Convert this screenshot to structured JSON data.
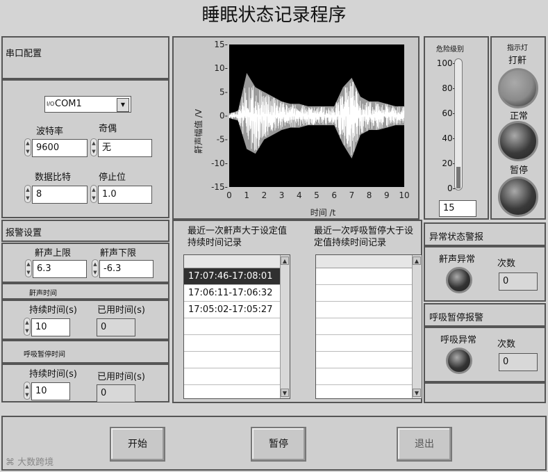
{
  "app": {
    "title": "睡眠状态记录程序"
  },
  "serial": {
    "section_label": "串口配置",
    "port_value": "COM1",
    "port_prefix": "I/O",
    "baud_label": "波特率",
    "baud_value": "9600",
    "parity_label": "奇偶",
    "parity_value": "无",
    "databits_label": "数据比特",
    "databits_value": "8",
    "stopbits_label": "停止位",
    "stopbits_value": "1.0"
  },
  "alarm": {
    "section_label": "报警设置",
    "upper_label": "鼾声上限",
    "upper_value": "6.3",
    "lower_label": "鼾声下限",
    "lower_value": "-6.3",
    "snore_time_label": "鼾声时间",
    "snore_duration_label": "持续时间(s)",
    "snore_duration_value": "10",
    "snore_elapsed_label": "已用时间(s)",
    "snore_elapsed_value": "0",
    "apnea_time_label": "呼吸暂停时间",
    "apnea_duration_label": "持续时间(s)",
    "apnea_duration_value": "10",
    "apnea_elapsed_label": "已用时间(s)",
    "apnea_elapsed_value": "0"
  },
  "chart_data": {
    "type": "line",
    "xlabel": "时间 /t",
    "ylabel": "鼾声幅值 /V",
    "xlim": [
      0,
      10
    ],
    "ylim": [
      -15,
      15
    ],
    "x_ticks": [
      "0",
      "1",
      "2",
      "3",
      "4",
      "5",
      "6",
      "7",
      "8",
      "9",
      "10"
    ],
    "y_ticks": [
      "15-",
      "10-",
      "5-",
      "0-",
      "-5-",
      "-10-",
      "-15-"
    ],
    "grid": false,
    "background": "#000000",
    "line_color": "#ffffff",
    "series": [
      {
        "x": [
          0,
          0.5,
          1,
          1.5,
          2,
          2.5,
          3,
          3.5,
          4,
          4.5,
          5,
          5.5,
          6,
          6.5,
          7,
          7.5,
          8,
          8.5,
          9,
          9.5,
          10
        ],
        "y_max": [
          0.5,
          1,
          9,
          6,
          5,
          4,
          3,
          2.5,
          2.5,
          2,
          2,
          2,
          2,
          6,
          8,
          4,
          3,
          3,
          2.5,
          2,
          2
        ],
        "y_min": [
          -0.5,
          -1,
          -7,
          -8,
          -5,
          -4,
          -3,
          -2.5,
          -2.5,
          -2,
          -2,
          -2,
          -2,
          -6,
          -9,
          -4,
          -3,
          -3,
          -2.5,
          -2,
          -2
        ]
      }
    ]
  },
  "danger": {
    "label": "危险级别",
    "ticks": [
      "100-",
      "80-",
      "60-",
      "40-",
      "20-",
      "0-"
    ],
    "level": 15,
    "scale_max": 100,
    "value_text": "15"
  },
  "indicators": {
    "label": "指示灯",
    "snore_label": "打鼾",
    "snore_color": "#8a8a8a",
    "normal_label": "正常",
    "normal_color": "#3a3a3a",
    "pause_label": "暂停",
    "pause_color": "#3a3a3a"
  },
  "records": {
    "snore_header": "最近一次鼾声大于设定值持续时间记录",
    "snore_items": [
      "17:07:46-17:08:01",
      "17:06:11-17:06:32",
      "17:05:02-17:05:27"
    ],
    "apnea_header": "最近一次呼吸暂停大于设定值持续时间记录",
    "apnea_items": []
  },
  "status": {
    "section_label": "异常状态警报",
    "snore_abnormal_label": "鼾声异常",
    "snore_count_label": "次数",
    "snore_count_value": "0",
    "apnea_section_label": "呼吸暂停报警",
    "apnea_abnormal_label": "呼吸异常",
    "apnea_count_label": "次数",
    "apnea_count_value": "0"
  },
  "controls": {
    "start": "开始",
    "pause": "暂停",
    "exit": "退出"
  },
  "watermark": "大数跨境"
}
